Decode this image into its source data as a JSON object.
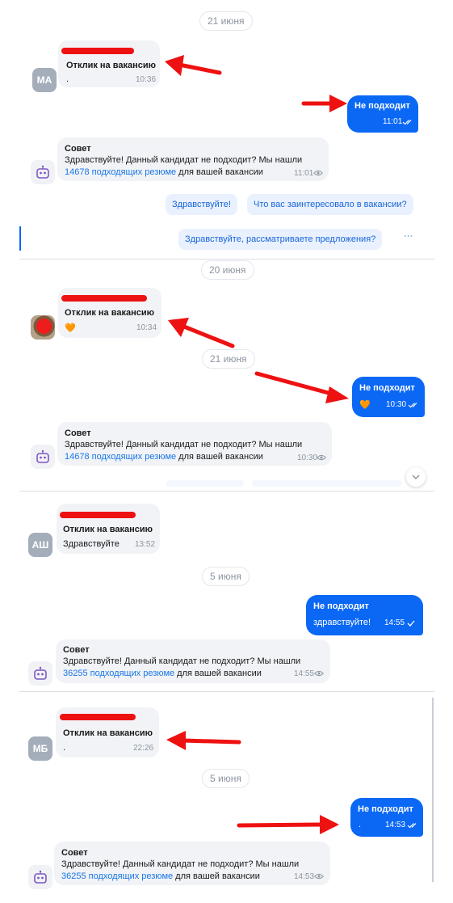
{
  "colors": {
    "accent": "#0a68f5",
    "redaction": "#ee1111",
    "link": "#1976e9",
    "chip_bg": "#e9f1fe"
  },
  "panels": [
    {
      "top_date": "21 июня",
      "avatar": "МА",
      "incoming": {
        "title": "Отклик на вакансию",
        "text": ".",
        "time": "10:36"
      },
      "outgoing": {
        "title": "Не подходит",
        "text": "",
        "time": "11:01"
      },
      "advice": {
        "title": "Совет",
        "line1": "Здравствуйте! Данный кандидат не подходит? Мы нашли",
        "count": "14678 подходящих резюме",
        "rest": " для вашей вакансии",
        "time": "11:01"
      },
      "chips": [
        "Здравствуйте!",
        "Что вас заинтересовало в вакансии?",
        "Здравствуйте, рассматриваете предложения?"
      ],
      "more": "···"
    },
    {
      "top_date": "20 июня",
      "incoming": {
        "title": "Отклик на вакансию",
        "text": "🧡",
        "time": "10:34"
      },
      "middle_date": "21 июня",
      "outgoing": {
        "title": "Не подходит",
        "text": "🧡",
        "time": "10:30"
      },
      "advice": {
        "title": "Совет",
        "line1": "Здравствуйте! Данный кандидат не подходит? Мы нашли",
        "count": "14678 подходящих резюме",
        "rest": " для вашей вакансии",
        "time": "10:30"
      }
    },
    {
      "avatar": "АШ",
      "incoming": {
        "title": "Отклик на вакансию",
        "text": "Здравствуйте",
        "time": "13:52"
      },
      "middle_date": "5 июня",
      "outgoing": {
        "title": "Не подходит",
        "text": "здравствуйте!",
        "time": "14:55"
      },
      "advice": {
        "title": "Совет",
        "line1": "Здравствуйте! Данный кандидат не подходит? Мы нашли",
        "count": "36255 подходящих резюме",
        "rest": " для вашей вакансии",
        "time": "14:55"
      }
    },
    {
      "avatar": "МБ",
      "incoming": {
        "title": "Отклик на вакансию",
        "text": ".",
        "time": "22:26"
      },
      "middle_date": "5 июня",
      "outgoing": {
        "title": "Не подходит",
        "text": ".",
        "time": "14:53"
      },
      "advice": {
        "title": "Совет",
        "line1": "Здравствуйте! Данный кандидат не подходит? Мы нашли",
        "count": "36255 подходящих резюме",
        "rest": " для вашей вакансии",
        "time": "14:53"
      }
    }
  ],
  "icons": {
    "read": "double-check-icon",
    "sent": "check-icon",
    "seen": "eye-icon",
    "bot": "robot-icon",
    "scroll": "chevron-down-icon"
  }
}
